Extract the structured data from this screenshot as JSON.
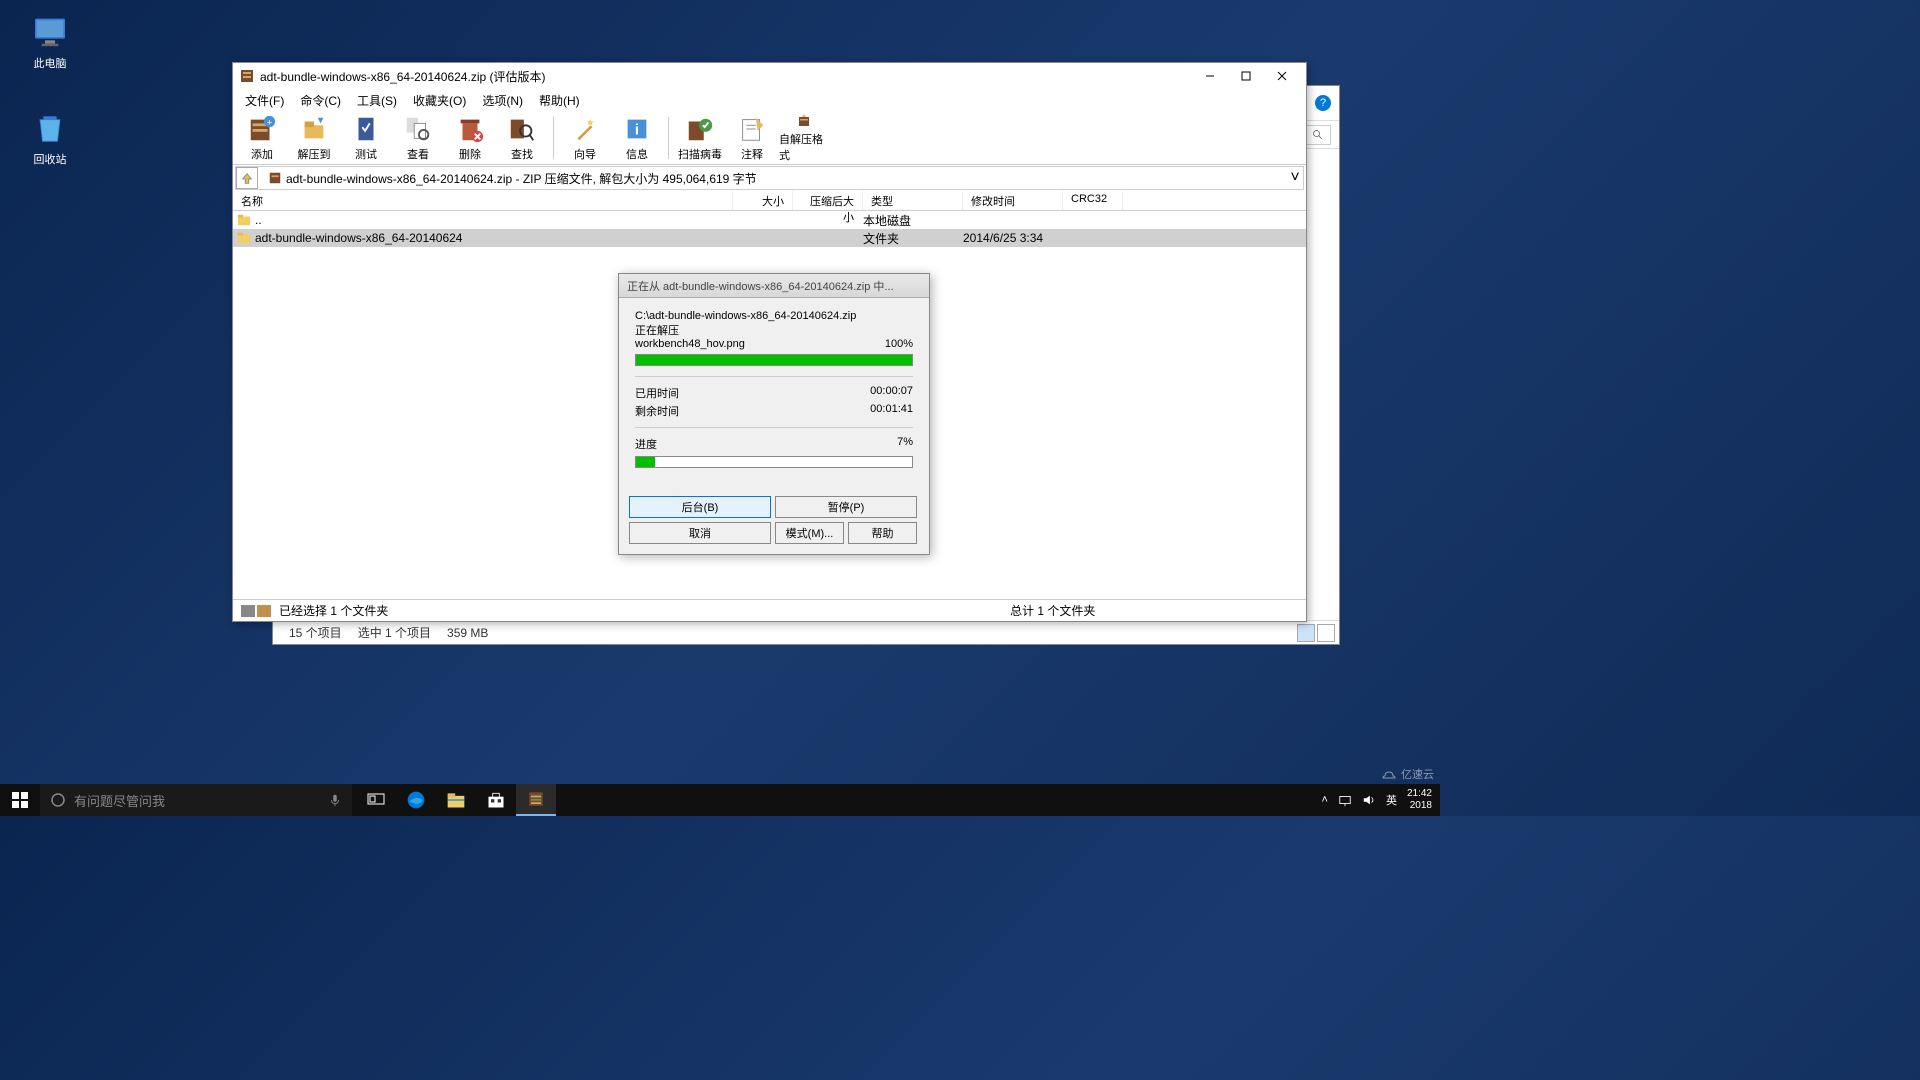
{
  "desktop": {
    "this_pc": "此电脑",
    "recycle": "回收站"
  },
  "explorer": {
    "status_items": "15 个项目",
    "status_selected": "选中 1 个项目",
    "status_size": "359 MB"
  },
  "winrar": {
    "title": "adt-bundle-windows-x86_64-20140624.zip (评估版本)",
    "menu": {
      "file": "文件(F)",
      "command": "命令(C)",
      "tools": "工具(S)",
      "favorites": "收藏夹(O)",
      "options": "选项(N)",
      "help": "帮助(H)"
    },
    "toolbar": {
      "add": "添加",
      "extract": "解压到",
      "test": "测试",
      "view": "查看",
      "delete": "删除",
      "find": "查找",
      "wizard": "向导",
      "info": "信息",
      "virus": "扫描病毒",
      "comment": "注释",
      "sfx": "自解压格式"
    },
    "path": "adt-bundle-windows-x86_64-20140624.zip - ZIP 压缩文件, 解包大小为 495,064,619 字节",
    "columns": {
      "name": "名称",
      "size": "大小",
      "packed": "压缩后大小",
      "type": "类型",
      "modified": "修改时间",
      "crc": "CRC32"
    },
    "rows": [
      {
        "name": "..",
        "type": "本地磁盘",
        "modified": ""
      },
      {
        "name": "adt-bundle-windows-x86_64-20140624",
        "type": "文件夹",
        "modified": "2014/6/25 3:34"
      }
    ],
    "status_selected": "已经选择 1 个文件夹",
    "status_total": "总计 1 个文件夹"
  },
  "progress": {
    "title": "正在从 adt-bundle-windows-x86_64-20140624.zip 中...",
    "archive_path": "C:\\adt-bundle-windows-x86_64-20140624.zip",
    "extracting_label": "正在解压",
    "current_file": "workbench48_hov.png",
    "file_pct": "100%",
    "file_progress": 100,
    "elapsed_label": "已用时间",
    "elapsed_value": "00:00:07",
    "remaining_label": "剩余时间",
    "remaining_value": "00:01:41",
    "progress_label": "进度",
    "total_pct": "7%",
    "total_progress": 7,
    "buttons": {
      "background": "后台(B)",
      "pause": "暂停(P)",
      "cancel": "取消",
      "mode": "模式(M)...",
      "help": "帮助"
    }
  },
  "taskbar": {
    "search_placeholder": "有问题尽管问我",
    "ime": "英",
    "time": "21:42",
    "date": "2018",
    "watermark": "亿速云"
  }
}
